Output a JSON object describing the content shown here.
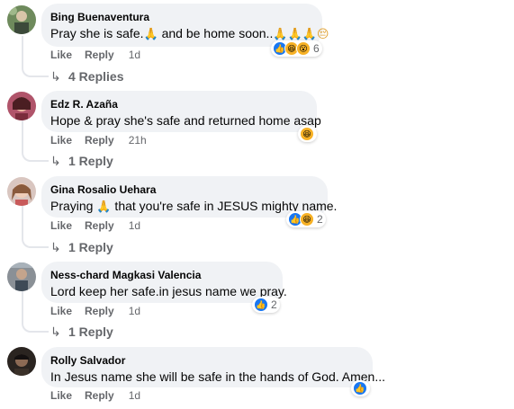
{
  "comments": [
    {
      "author": "Bing Buenaventura",
      "text_a": "Pray she is safe.",
      "text_b": " and be home soon..",
      "emoji_pray": "🙏",
      "emoji_sad": "😔",
      "like": "Like",
      "reply": "Reply",
      "time": "1d",
      "reaction_count": "6",
      "replies": "4 Replies"
    },
    {
      "author": "Edz R. Azaña",
      "text": "Hope & pray she's safe and returned home asap",
      "like": "Like",
      "reply": "Reply",
      "time": "21h",
      "replies": "1 Reply"
    },
    {
      "author": "Gina Rosalio Uehara",
      "text_a": "Praying ",
      "emoji_pray": "🙏",
      "text_b": " that you're safe in JESUS mighty name.",
      "like": "Like",
      "reply": "Reply",
      "time": "1d",
      "reaction_count": "2",
      "replies": "1 Reply"
    },
    {
      "author": "Ness-chard Magkasi Valencia",
      "text": "Lord keep her safe.in jesus name we pray.",
      "like": "Like",
      "reply": "Reply",
      "time": "1d",
      "reaction_count": "2",
      "replies": "1 Reply"
    },
    {
      "author": "Rolly Salvador",
      "text": "In Jesus name she will be safe in the hands of God. Amen...",
      "like": "Like",
      "reply": "Reply",
      "time": "1d"
    }
  ],
  "colors": {
    "bubble": "#f0f2f5",
    "meta": "#65676b",
    "like_blue": "#1877f2",
    "haha_yellow": "#f7b125"
  },
  "icons": {
    "reply_arrow": "reply-arrow-icon",
    "like": "like-reaction-icon",
    "haha": "haha-reaction-icon",
    "wow": "wow-reaction-icon"
  }
}
